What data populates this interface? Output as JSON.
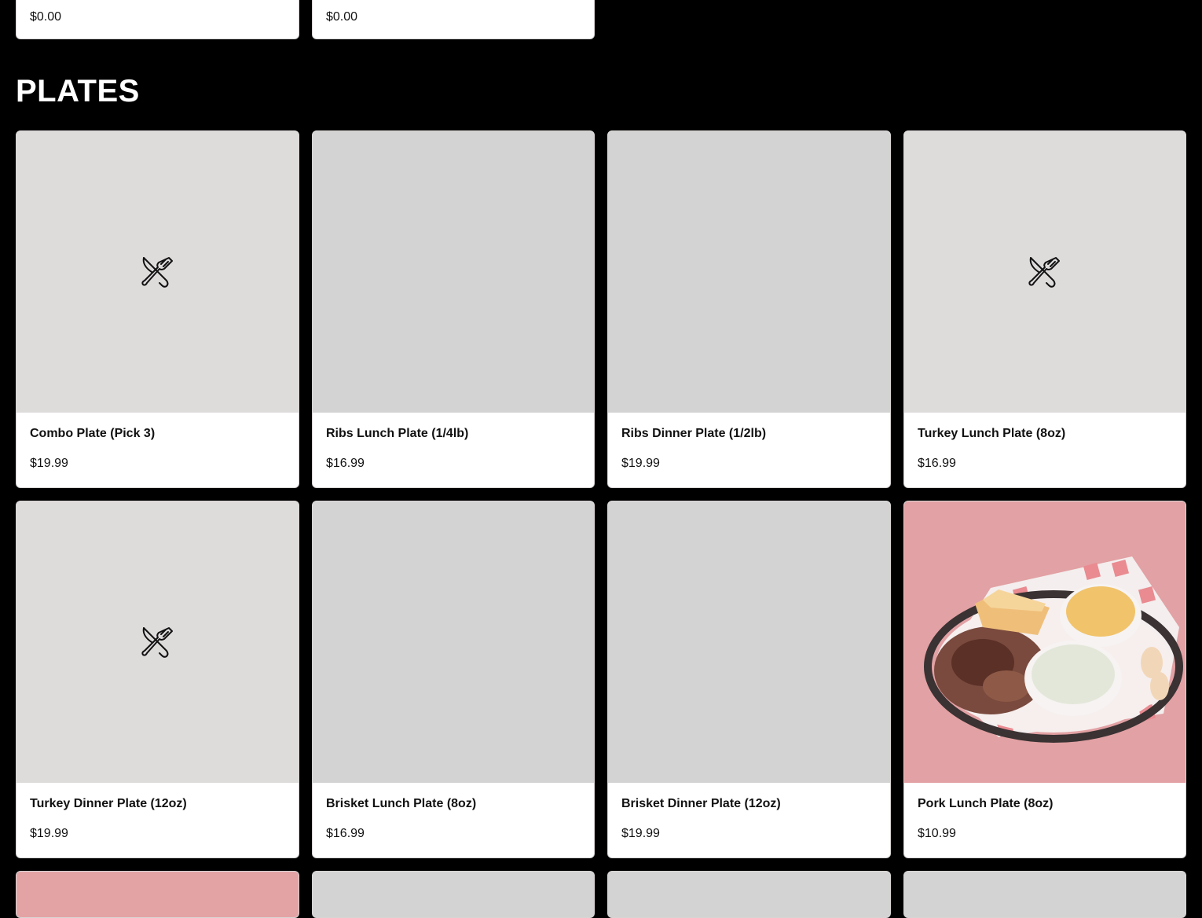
{
  "top_row": [
    {
      "price": "$0.00"
    },
    {
      "price": "$0.00"
    }
  ],
  "section": {
    "title": "PLATES"
  },
  "items": [
    {
      "name": "Combo Plate (Pick 3)",
      "price": "$19.99",
      "image": "placeholder-utensils-icon"
    },
    {
      "name": "Ribs Lunch Plate (1/4lb)",
      "price": "$16.99",
      "image": "gray"
    },
    {
      "name": "Ribs Dinner Plate (1/2lb)",
      "price": "$19.99",
      "image": "gray"
    },
    {
      "name": "Turkey Lunch Plate (8oz)",
      "price": "$16.99",
      "image": "placeholder-utensils-icon"
    },
    {
      "name": "Turkey Dinner Plate (12oz)",
      "price": "$19.99",
      "image": "placeholder-utensils-icon"
    },
    {
      "name": "Brisket Lunch Plate (8oz)",
      "price": "$16.99",
      "image": "gray"
    },
    {
      "name": "Brisket Dinner Plate (12oz)",
      "price": "$19.99",
      "image": "gray"
    },
    {
      "name": "Pork Lunch Plate (8oz)",
      "price": "$10.99",
      "image": "food-photo"
    }
  ],
  "colors": {
    "background": "#000000",
    "card": "#ffffff",
    "image_gray": "#d3d3d3",
    "photo_bg": "#e4a3a6"
  }
}
